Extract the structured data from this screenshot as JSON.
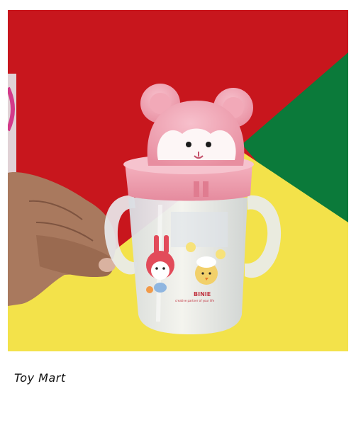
{
  "photo": {
    "product_brand": "BINIE",
    "product_tagline": "creative partner of your life"
  },
  "caption": {
    "text": "Toy Mart"
  },
  "colors": {
    "red_backdrop": "#c8161d",
    "green_backdrop": "#0b7a3a",
    "yellow_backdrop": "#f3e24a",
    "cup_pink": "#f2a7b5",
    "cup_body": "#eef0f2"
  }
}
